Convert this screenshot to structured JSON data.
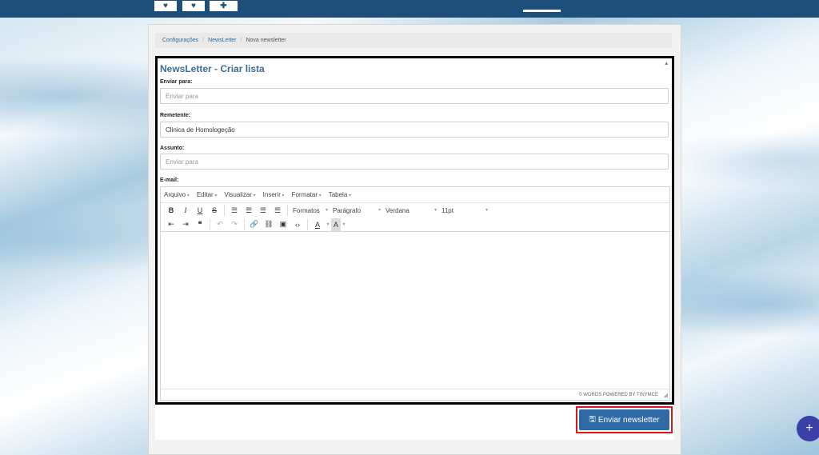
{
  "breadcrumb": {
    "items": [
      "Configurações",
      "NewsLetter"
    ],
    "current": "Nova newsletter"
  },
  "form": {
    "title": "NewsLetter - Criar lista",
    "send_to": {
      "label": "Enviar para:",
      "placeholder": "Enviar para",
      "value": ""
    },
    "sender": {
      "label": "Remetente:",
      "value": "Clinica de Homologeção"
    },
    "subject": {
      "label": "Assunto:",
      "placeholder": "Enviar para",
      "value": ""
    },
    "email_label": "E-mail:"
  },
  "editor": {
    "menu": [
      "Arquivo",
      "Editar",
      "Visualizar",
      "Inserir",
      "Formatar",
      "Tabela"
    ],
    "formats": "Formatos",
    "block": "Parágrafo",
    "font": "Verdana",
    "size": "11pt",
    "status": "0 WORDS POWERED BY TINYMCE"
  },
  "actions": {
    "send_label": "Enviar newsletter",
    "fab_label": "+"
  },
  "colors": {
    "topbar": "#1e4f7a",
    "accent": "#2f6aa7",
    "highlight": "#e0151b",
    "title": "#3d6c98"
  }
}
